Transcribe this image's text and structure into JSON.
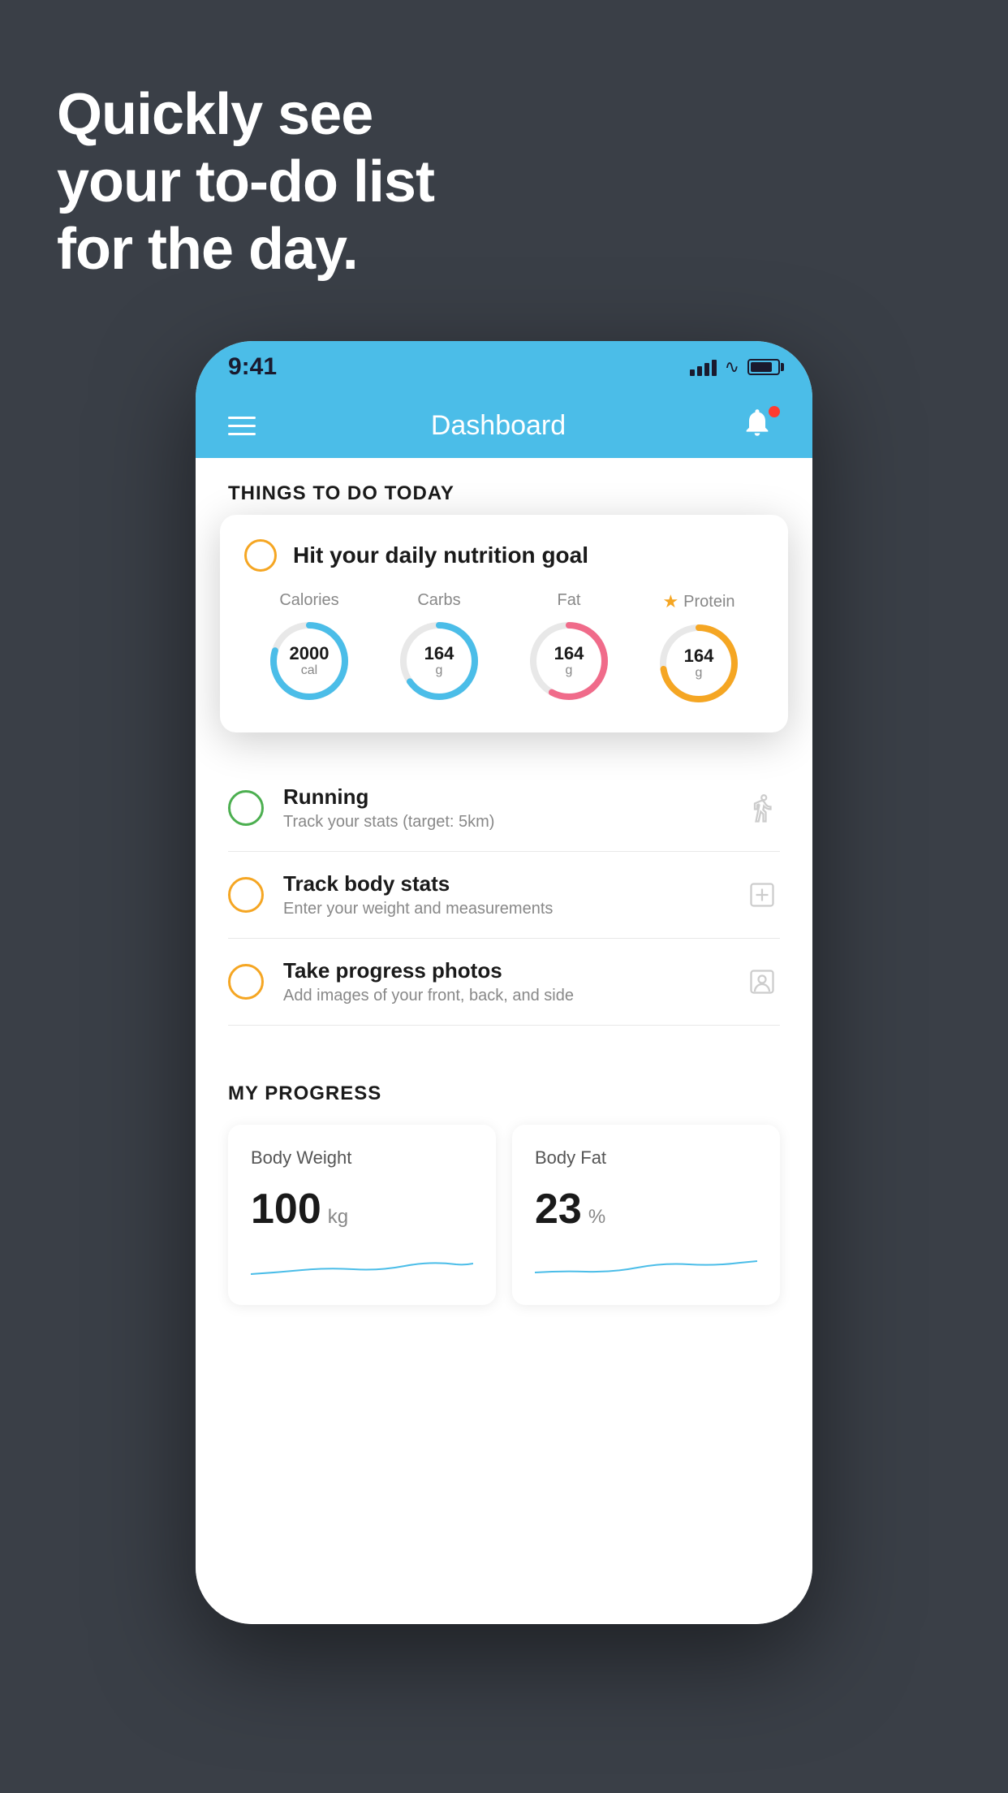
{
  "hero": {
    "line1": "Quickly see",
    "line2": "your to-do list",
    "line3": "for the day."
  },
  "status_bar": {
    "time": "9:41"
  },
  "nav_bar": {
    "title": "Dashboard"
  },
  "things_to_do": {
    "section_title": "THINGS TO DO TODAY"
  },
  "floating_card": {
    "title": "Hit your daily nutrition goal",
    "nutrition": [
      {
        "label": "Calories",
        "value": "2000",
        "unit": "cal",
        "color": "calories",
        "starred": false
      },
      {
        "label": "Carbs",
        "value": "164",
        "unit": "g",
        "color": "carbs",
        "starred": false
      },
      {
        "label": "Fat",
        "value": "164",
        "unit": "g",
        "color": "fat",
        "starred": false
      },
      {
        "label": "Protein",
        "value": "164",
        "unit": "g",
        "color": "protein",
        "starred": true
      }
    ]
  },
  "todo_items": [
    {
      "id": "running",
      "title": "Running",
      "subtitle": "Track your stats (target: 5km)",
      "circle_color": "green",
      "icon": "shoe"
    },
    {
      "id": "track-body",
      "title": "Track body stats",
      "subtitle": "Enter your weight and measurements",
      "circle_color": "yellow",
      "icon": "scale"
    },
    {
      "id": "progress-photos",
      "title": "Take progress photos",
      "subtitle": "Add images of your front, back, and side",
      "circle_color": "yellow",
      "icon": "person"
    }
  ],
  "progress": {
    "section_title": "MY PROGRESS",
    "cards": [
      {
        "title": "Body Weight",
        "value": "100",
        "unit": "kg"
      },
      {
        "title": "Body Fat",
        "value": "23",
        "unit": "%"
      }
    ]
  }
}
